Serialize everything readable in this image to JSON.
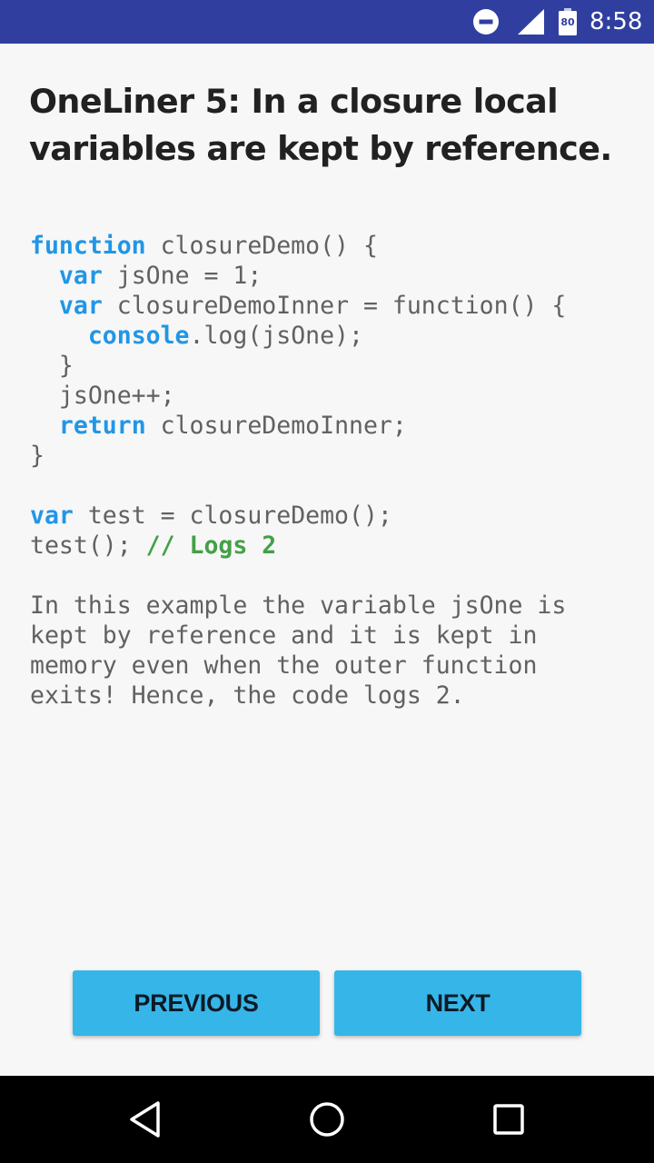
{
  "status_bar": {
    "icons": [
      "do-not-disturb-icon",
      "cell-signal-icon",
      "battery-icon"
    ],
    "battery_level": "80",
    "time": "8:58",
    "background_color": "#303f9f"
  },
  "page": {
    "title": "OneLiner 5: In a closure local variables are kept by reference.",
    "code_lines": [
      [
        {
          "t": "function",
          "k": "kw"
        },
        {
          "t": " closureDemo() {"
        }
      ],
      [
        {
          "t": "  "
        },
        {
          "t": "var",
          "k": "kw"
        },
        {
          "t": " jsOne = 1;"
        }
      ],
      [
        {
          "t": "  "
        },
        {
          "t": "var",
          "k": "kw"
        },
        {
          "t": " closureDemoInner = function() {"
        }
      ],
      [
        {
          "t": "    "
        },
        {
          "t": "console",
          "k": "kw"
        },
        {
          "t": ".log(jsOne);"
        }
      ],
      [
        {
          "t": "  }"
        }
      ],
      [
        {
          "t": "  jsOne++;"
        }
      ],
      [
        {
          "t": "  "
        },
        {
          "t": "return",
          "k": "kw"
        },
        {
          "t": " closureDemoInner;"
        }
      ],
      [
        {
          "t": "}"
        }
      ],
      [
        {
          "t": ""
        }
      ],
      [
        {
          "t": "var",
          "k": "kw"
        },
        {
          "t": " test = closureDemo();"
        }
      ],
      [
        {
          "t": "test(); "
        },
        {
          "t": "// Logs 2",
          "k": "cm"
        }
      ]
    ],
    "explanation_lines": [
      "In this example the variable jsOne is",
      "kept by reference and it is kept in",
      "memory even when the outer function",
      "exits! Hence, the code logs 2."
    ],
    "keyword_color": "#2196e6",
    "comment_color": "#43a047"
  },
  "buttons": {
    "previous_label": "PREVIOUS",
    "next_label": "NEXT",
    "color": "#36b5e8"
  },
  "nav_bar": {
    "icons": [
      "back-icon",
      "home-icon",
      "recent-apps-icon"
    ]
  }
}
